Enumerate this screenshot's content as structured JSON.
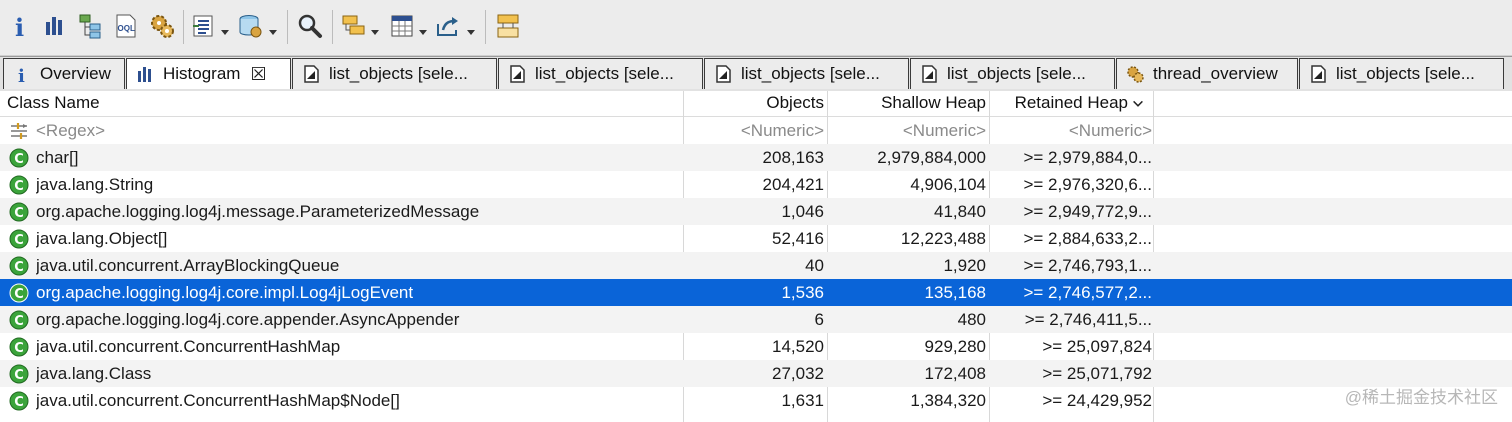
{
  "toolbar": {
    "buttons": [
      {
        "name": "info-icon",
        "has_dropdown": false
      },
      {
        "name": "histogram-icon",
        "has_dropdown": false
      },
      {
        "name": "dominator-tree-icon",
        "has_dropdown": false
      },
      {
        "name": "oql-icon",
        "has_dropdown": false
      },
      {
        "name": "thread-overview-icon",
        "has_dropdown": false
      },
      {
        "name": "query-browser-icon",
        "has_dropdown": true
      },
      {
        "name": "heap-dump-overview-icon",
        "has_dropdown": true
      },
      {
        "name": "search-icon",
        "has_dropdown": false
      },
      {
        "name": "group-by-icon",
        "has_dropdown": true
      },
      {
        "name": "calculator-icon",
        "has_dropdown": true
      },
      {
        "name": "export-icon",
        "has_dropdown": true
      },
      {
        "name": "compare-icon",
        "has_dropdown": false
      }
    ]
  },
  "tabs": [
    {
      "label": "Overview",
      "icon": "info-icon",
      "active": false
    },
    {
      "label": "Histogram",
      "icon": "histogram-icon",
      "active": true,
      "closable": true
    },
    {
      "label": "list_objects [sele...",
      "icon": "list-objects-icon",
      "active": false
    },
    {
      "label": "list_objects [sele...",
      "icon": "list-objects-icon",
      "active": false
    },
    {
      "label": "list_objects [sele...",
      "icon": "list-objects-icon",
      "active": false
    },
    {
      "label": "list_objects [sele...",
      "icon": "list-objects-icon",
      "active": false
    },
    {
      "label": "thread_overview",
      "icon": "thread-overview-icon",
      "active": false
    },
    {
      "label": "list_objects [sele...",
      "icon": "list-objects-icon",
      "active": false
    }
  ],
  "table": {
    "columns": {
      "class_name": "Class Name",
      "objects": "Objects",
      "shallow_heap": "Shallow Heap",
      "retained_heap": "Retained Heap",
      "sort_icon": "chevron-down-icon"
    },
    "filter_row": {
      "class_name": "<Regex>",
      "objects": "<Numeric>",
      "shallow_heap": "<Numeric>",
      "retained_heap": "<Numeric>"
    },
    "rows": [
      {
        "class_name": "char[]",
        "objects": "208,163",
        "shallow_heap": "2,979,884,000",
        "retained_heap": ">= 2,979,884,0...",
        "selected": false
      },
      {
        "class_name": "java.lang.String",
        "objects": "204,421",
        "shallow_heap": "4,906,104",
        "retained_heap": ">= 2,976,320,6...",
        "selected": false
      },
      {
        "class_name": "org.apache.logging.log4j.message.ParameterizedMessage",
        "objects": "1,046",
        "shallow_heap": "41,840",
        "retained_heap": ">= 2,949,772,9...",
        "selected": false
      },
      {
        "class_name": "java.lang.Object[]",
        "objects": "52,416",
        "shallow_heap": "12,223,488",
        "retained_heap": ">= 2,884,633,2...",
        "selected": false
      },
      {
        "class_name": "java.util.concurrent.ArrayBlockingQueue",
        "objects": "40",
        "shallow_heap": "1,920",
        "retained_heap": ">= 2,746,793,1...",
        "selected": false
      },
      {
        "class_name": "org.apache.logging.log4j.core.impl.Log4jLogEvent",
        "objects": "1,536",
        "shallow_heap": "135,168",
        "retained_heap": ">= 2,746,577,2...",
        "selected": true
      },
      {
        "class_name": "org.apache.logging.log4j.core.appender.AsyncAppender",
        "objects": "6",
        "shallow_heap": "480",
        "retained_heap": ">= 2,746,411,5...",
        "selected": false
      },
      {
        "class_name": "java.util.concurrent.ConcurrentHashMap",
        "objects": "14,520",
        "shallow_heap": "929,280",
        "retained_heap": ">= 25,097,824",
        "selected": false
      },
      {
        "class_name": "java.lang.Class",
        "objects": "27,032",
        "shallow_heap": "172,408",
        "retained_heap": ">= 25,071,792",
        "selected": false
      },
      {
        "class_name": "java.util.concurrent.ConcurrentHashMap$Node[]",
        "objects": "1,631",
        "shallow_heap": "1,384,320",
        "retained_heap": ">= 24,429,952",
        "selected": false
      }
    ]
  },
  "watermark": "@稀土掘金技术社区",
  "colors": {
    "selection": "#0a64d8",
    "class_icon": "#3ba43b",
    "toolbar_bg": "#ececec"
  }
}
